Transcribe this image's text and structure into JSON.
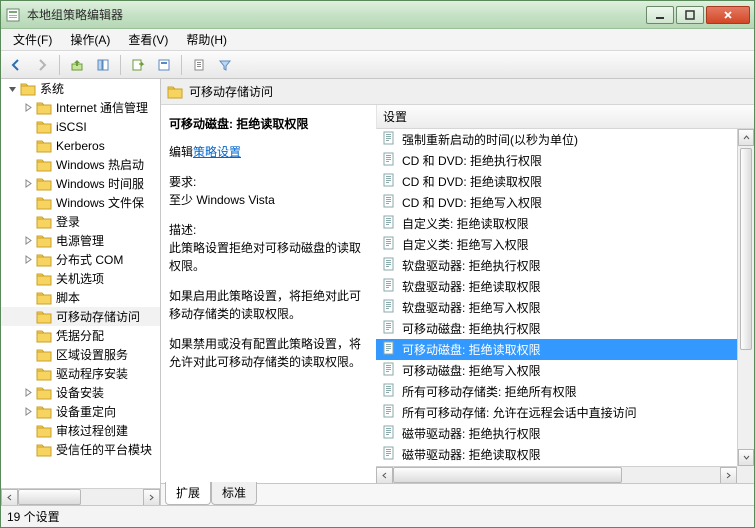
{
  "window": {
    "title": "本地组策略编辑器"
  },
  "menu": {
    "file": "文件(F)",
    "action": "操作(A)",
    "view": "查看(V)",
    "help": "帮助(H)"
  },
  "sidebar": {
    "root": "系统",
    "items": [
      {
        "label": "Internet 通信管理"
      },
      {
        "label": "iSCSI"
      },
      {
        "label": "Kerberos"
      },
      {
        "label": "Windows 热启动"
      },
      {
        "label": "Windows 时间服"
      },
      {
        "label": "Windows 文件保"
      },
      {
        "label": "登录"
      },
      {
        "label": "电源管理"
      },
      {
        "label": "分布式 COM"
      },
      {
        "label": "关机选项"
      },
      {
        "label": "脚本"
      },
      {
        "label": "可移动存储访问",
        "selected": true
      },
      {
        "label": "凭据分配"
      },
      {
        "label": "区域设置服务"
      },
      {
        "label": "驱动程序安装"
      },
      {
        "label": "设备安装"
      },
      {
        "label": "设备重定向"
      },
      {
        "label": "审核过程创建"
      },
      {
        "label": "受信任的平台模块"
      }
    ]
  },
  "header": {
    "title": "可移动存储访问"
  },
  "desc": {
    "title": "可移动磁盘: 拒绝读取权限",
    "edit_prefix": "编辑",
    "edit_link": "策略设置",
    "req_label": "要求:",
    "req_value": "至少 Windows Vista",
    "desc_label": "描述:",
    "desc_body1": "此策略设置拒绝对可移动磁盘的读取权限。",
    "desc_body2": "如果启用此策略设置，将拒绝对此可移动存储类的读取权限。",
    "desc_body3": "如果禁用或没有配置此策略设置，将允许对此可移动存储类的读取权限。"
  },
  "list": {
    "col": "设置",
    "items": [
      "强制重新启动的时间(以秒为单位)",
      "CD 和 DVD: 拒绝执行权限",
      "CD 和 DVD: 拒绝读取权限",
      "CD 和 DVD: 拒绝写入权限",
      "自定义类: 拒绝读取权限",
      "自定义类: 拒绝写入权限",
      "软盘驱动器: 拒绝执行权限",
      "软盘驱动器: 拒绝读取权限",
      "软盘驱动器: 拒绝写入权限",
      "可移动磁盘: 拒绝执行权限",
      "可移动磁盘: 拒绝读取权限",
      "可移动磁盘: 拒绝写入权限",
      "所有可移动存储类: 拒绝所有权限",
      "所有可移动存储: 允许在远程会话中直接访问",
      "磁带驱动器: 拒绝执行权限",
      "磁带驱动器: 拒绝读取权限"
    ],
    "selected_index": 10
  },
  "tabs": {
    "extended": "扩展",
    "standard": "标准"
  },
  "status": {
    "text": "19 个设置"
  }
}
